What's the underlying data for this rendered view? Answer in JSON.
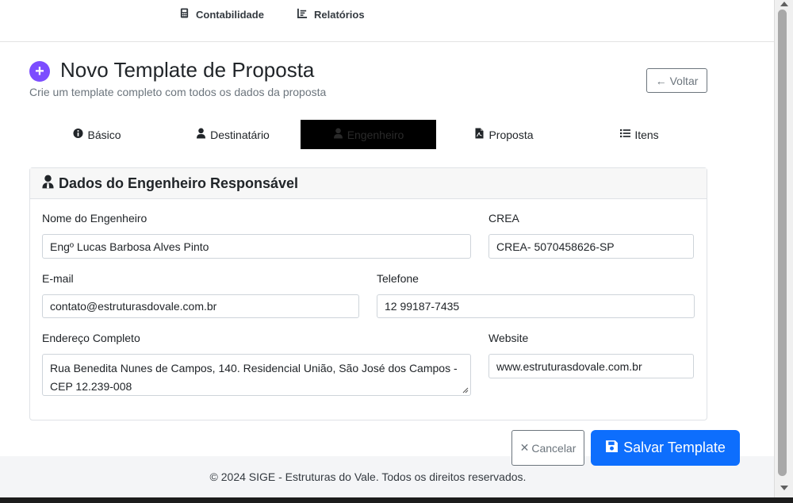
{
  "nav": {
    "items": [
      {
        "label": "Contabilidade",
        "icon": "calculator-icon"
      },
      {
        "label": "Relatórios",
        "icon": "chart-icon"
      }
    ]
  },
  "header": {
    "title": "Novo Template de Proposta",
    "subtitle": "Crie um template completo com todos os dados da proposta",
    "add_icon": "+",
    "back_label": "Voltar",
    "back_arrow": "←"
  },
  "tabs": [
    {
      "label": "Básico",
      "icon": "info-circle-icon",
      "active": false
    },
    {
      "label": "Destinatário",
      "icon": "user-icon",
      "active": false
    },
    {
      "label": "Engenheiro",
      "icon": "user-tie-icon",
      "active": true
    },
    {
      "label": "Proposta",
      "icon": "file-pdf-icon",
      "active": false
    },
    {
      "label": "Itens",
      "icon": "list-icon",
      "active": false
    }
  ],
  "card": {
    "title": "Dados do Engenheiro Responsável"
  },
  "form": {
    "nome_label": "Nome do Engenheiro",
    "nome_value": "Engº Lucas Barbosa Alves Pinto",
    "crea_label": "CREA",
    "crea_value": "CREA- 5070458626-SP",
    "email_label": "E-mail",
    "email_value": "contato@estruturasdovale.com.br",
    "telefone_label": "Telefone",
    "telefone_value": "12 99187-7435",
    "endereco_label": "Endereço Completo",
    "endereco_value": "Rua Benedita Nunes de Campos, 140. Residencial União, São José dos Campos - CEP 12.239-008",
    "website_label": "Website",
    "website_value": "www.estruturasdovale.com.br"
  },
  "actions": {
    "cancel_label": "Cancelar",
    "cancel_icon": "✕",
    "save_label": "Salvar Template"
  },
  "footer": {
    "text": "© 2024 SIGE - Estruturas do Vale. Todos os direitos reservados."
  },
  "colors": {
    "accent": "#0d6efd",
    "purple": "#7c4dff",
    "active_tab": "#000000"
  }
}
